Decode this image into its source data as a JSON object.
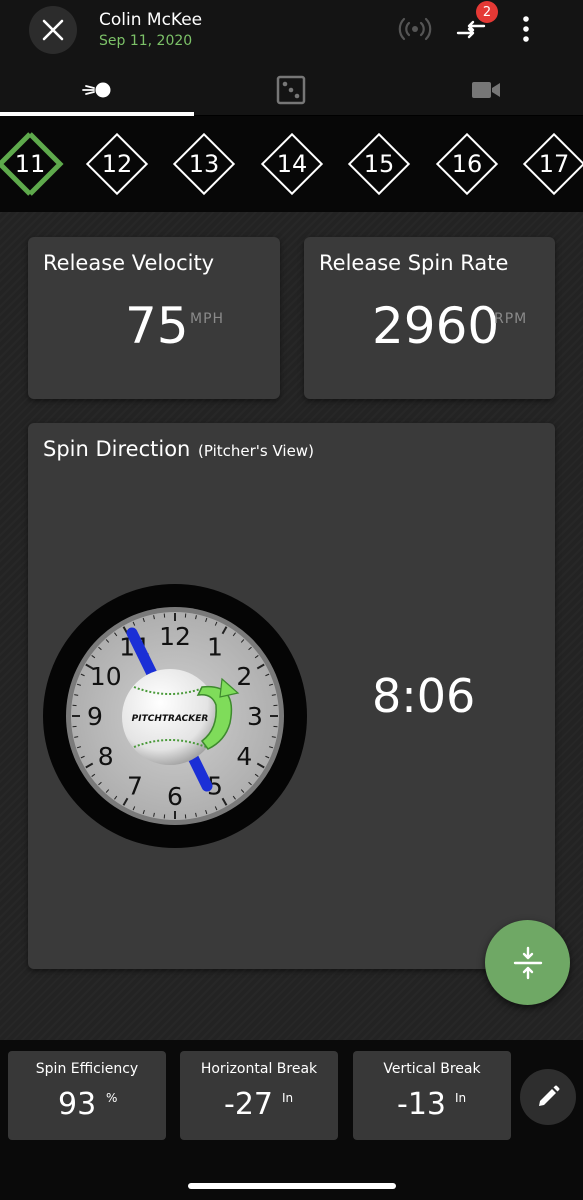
{
  "header": {
    "user_name": "Colin McKee",
    "date": "Sep 11, 2020",
    "sync_badge_count": "2",
    "accent_color": "#7cc168"
  },
  "tabs": [
    {
      "name": "pitch-data",
      "icon": "baseball-motion-icon",
      "active": true
    },
    {
      "name": "strike-zone",
      "icon": "dice-icon",
      "active": false
    },
    {
      "name": "video",
      "icon": "video-camera-icon",
      "active": false
    }
  ],
  "pitches": [
    {
      "label": "11",
      "active": true
    },
    {
      "label": "12",
      "active": false
    },
    {
      "label": "13",
      "active": false
    },
    {
      "label": "14",
      "active": false
    },
    {
      "label": "15",
      "active": false
    },
    {
      "label": "16",
      "active": false
    },
    {
      "label": "17",
      "active": false
    }
  ],
  "release_velocity": {
    "title": "Release Velocity",
    "value": "75",
    "unit": "MPH"
  },
  "release_spin_rate": {
    "title": "Release Spin Rate",
    "value": "2960",
    "unit": "RPM"
  },
  "spin_direction": {
    "title": "Spin Direction",
    "subtitle": "(Pitcher's View)",
    "value": "8:06",
    "clock_numbers": [
      "12",
      "1",
      "2",
      "3",
      "4",
      "5",
      "6",
      "7",
      "8",
      "9",
      "10",
      "11"
    ],
    "ball_logo_text": "PITCHTRACKER"
  },
  "stats": [
    {
      "label": "Spin Efficiency",
      "value": "93",
      "unit": "%"
    },
    {
      "label": "Horizontal Break",
      "value": "-27",
      "unit": "In"
    },
    {
      "label": "Vertical Break",
      "value": "-13",
      "unit": "In"
    }
  ],
  "fab_color": "#6fa865",
  "active_pitch_color": "#5ea94c"
}
